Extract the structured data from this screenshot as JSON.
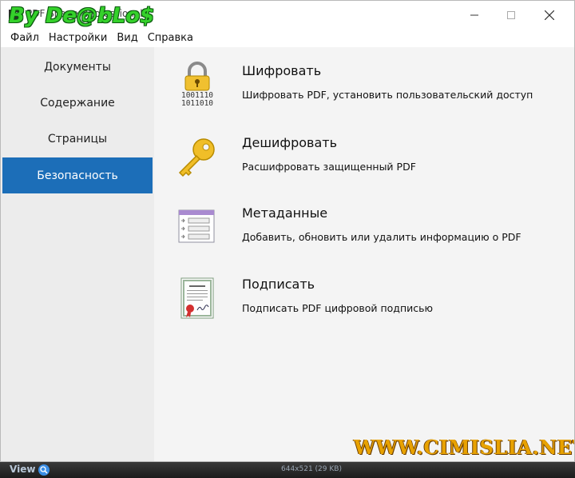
{
  "window": {
    "title": "PDF Shaper Professional",
    "watermark": "By De@bLo$"
  },
  "menu": [
    "Файл",
    "Настройки",
    "Вид",
    "Справка"
  ],
  "sidebar": {
    "items": [
      {
        "label": "Документы"
      },
      {
        "label": "Содержание"
      },
      {
        "label": "Страницы"
      },
      {
        "label": "Безопасность",
        "active": true
      }
    ]
  },
  "actions": [
    {
      "icon": "lock-binary-icon",
      "title": "Шифровать",
      "description": "Шифровать PDF, установить пользовательский доступ",
      "binary": [
        "1001110",
        "1011010"
      ]
    },
    {
      "icon": "key-icon",
      "title": "Дешифровать",
      "description": "Расшифровать защищенный PDF"
    },
    {
      "icon": "metadata-list-icon",
      "title": "Метаданные",
      "description": "Добавить, обновить или удалить информацию о PDF"
    },
    {
      "icon": "certificate-icon",
      "title": "Подписать",
      "description": "Подписать PDF цифровой подписью"
    }
  ],
  "watermark_bottom": "WWW.CIMISLIA.NET",
  "viewer": {
    "label": "View",
    "size_text": "644x521 (29 KB)"
  },
  "colors": {
    "accent": "#1c6eb8",
    "sidebar_bg": "#ececec",
    "content_bg": "#f4f4f4",
    "watermark_green": "#35d12b",
    "watermark_orange": "#e8a200"
  }
}
